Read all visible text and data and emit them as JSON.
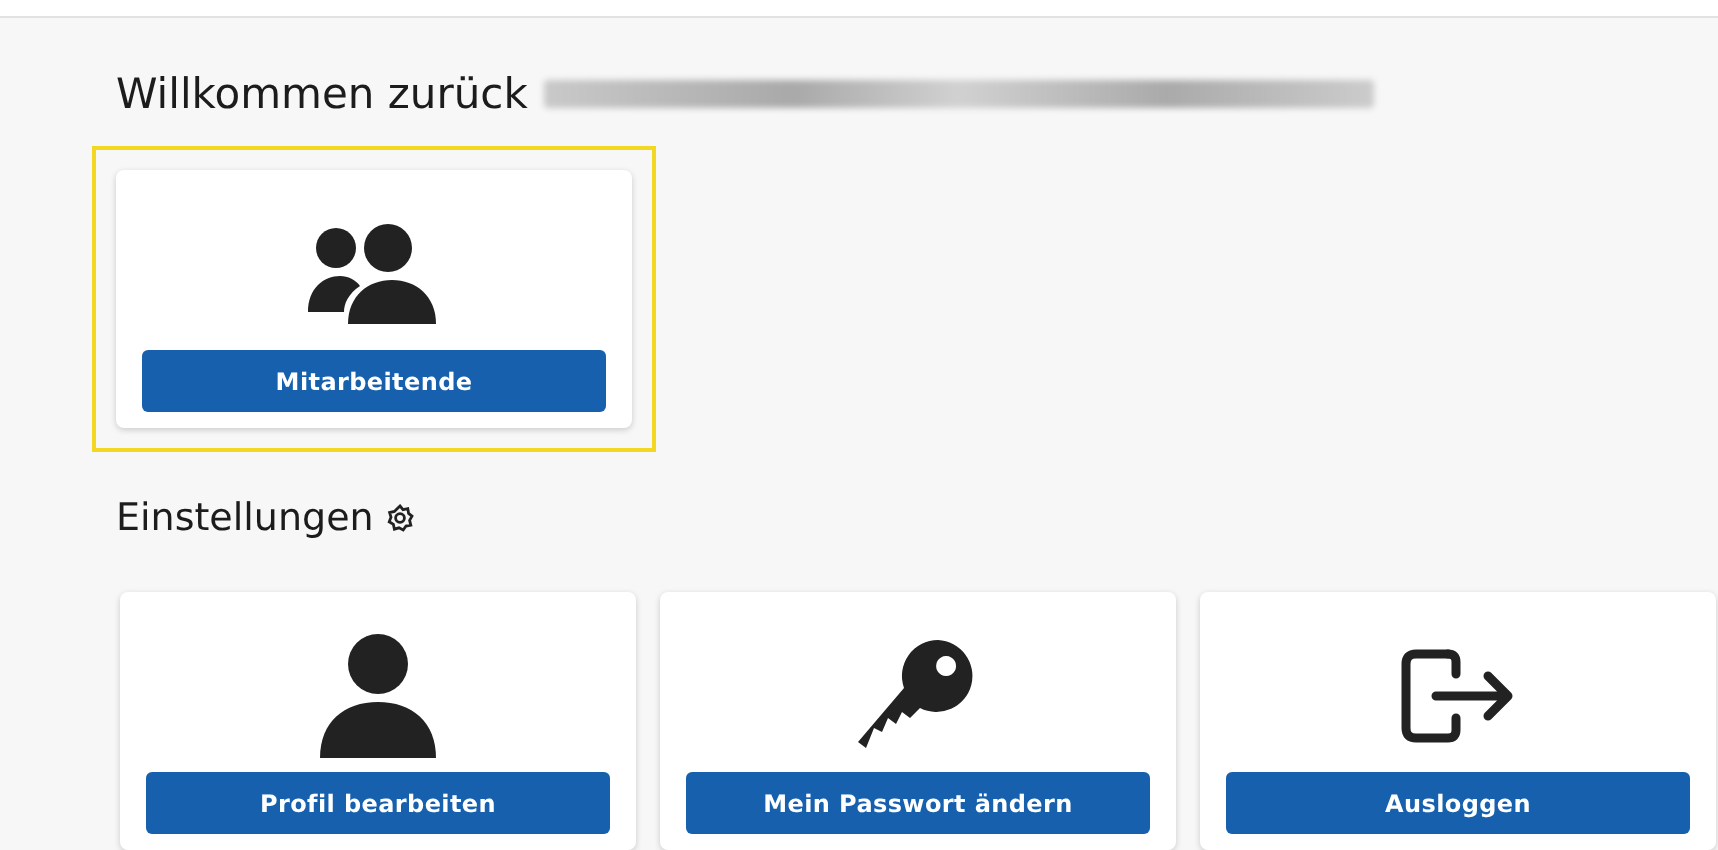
{
  "welcome": {
    "title": "Willkommen zurück"
  },
  "main_tiles": [
    {
      "kind": "people",
      "button": "Mitarbeitende",
      "highlighted": true
    }
  ],
  "settings": {
    "title": "Einstellungen"
  },
  "settings_tiles": [
    {
      "kind": "person",
      "button": "Profil bearbeiten",
      "highlighted": false
    },
    {
      "kind": "key",
      "button": "Mein Passwort ändern",
      "highlighted": false
    },
    {
      "kind": "logout",
      "button": "Ausloggen",
      "highlighted": false
    }
  ]
}
